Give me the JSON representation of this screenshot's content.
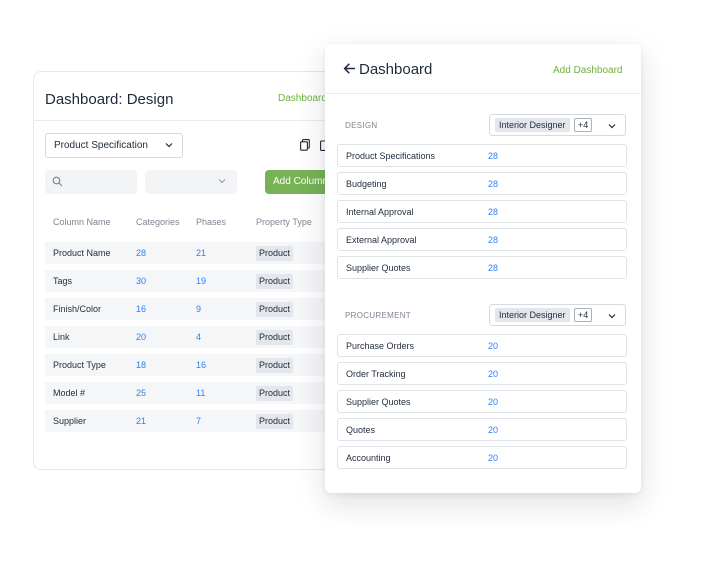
{
  "back_panel": {
    "title": "Dashboard: Design",
    "link": "Dashboard",
    "select_value": "Product Specification",
    "add_button": "Add Column",
    "columns": [
      "Column Name",
      "Categories",
      "Phases",
      "Property Type"
    ],
    "rows": [
      {
        "name": "Product Name",
        "categories": "28",
        "phases": "21",
        "type": "Product"
      },
      {
        "name": "Tags",
        "categories": "30",
        "phases": "19",
        "type": "Product"
      },
      {
        "name": "Finish/Color",
        "categories": "16",
        "phases": "9",
        "type": "Product"
      },
      {
        "name": "Link",
        "categories": "20",
        "phases": "4",
        "type": "Product"
      },
      {
        "name": "Product Type",
        "categories": "18",
        "phases": "16",
        "type": "Product"
      },
      {
        "name": "Model #",
        "categories": "25",
        "phases": "11",
        "type": "Product"
      },
      {
        "name": "Supplier",
        "categories": "21",
        "phases": "7",
        "type": "Product"
      }
    ]
  },
  "front_panel": {
    "title": "Dashboard",
    "add_link": "Add Dashboard",
    "sections": [
      {
        "label": "DESIGN",
        "role": "Interior Designer",
        "more": "+4",
        "items": [
          {
            "label": "Product Specifications",
            "count": "28"
          },
          {
            "label": "Budgeting",
            "count": "28"
          },
          {
            "label": "Internal Approval",
            "count": "28"
          },
          {
            "label": "External Approval",
            "count": "28"
          },
          {
            "label": "Supplier Quotes",
            "count": "28"
          }
        ]
      },
      {
        "label": "PROCUREMENT",
        "role": "Interior Designer",
        "more": "+4",
        "items": [
          {
            "label": "Purchase Orders",
            "count": "20"
          },
          {
            "label": "Order Tracking",
            "count": "20"
          },
          {
            "label": "Supplier Quotes",
            "count": "20"
          },
          {
            "label": "Quotes",
            "count": "20"
          },
          {
            "label": "Accounting",
            "count": "20"
          }
        ]
      }
    ]
  },
  "colors": {
    "accent_green": "#77b255",
    "link_green": "#6db33f",
    "number_blue": "#2f80ed",
    "text_dark": "#1f2a3c",
    "text_muted": "#7d8593"
  },
  "icons": [
    "copy-icon",
    "trash-icon",
    "search-icon",
    "chevron-down-icon",
    "arrow-left-icon"
  ]
}
